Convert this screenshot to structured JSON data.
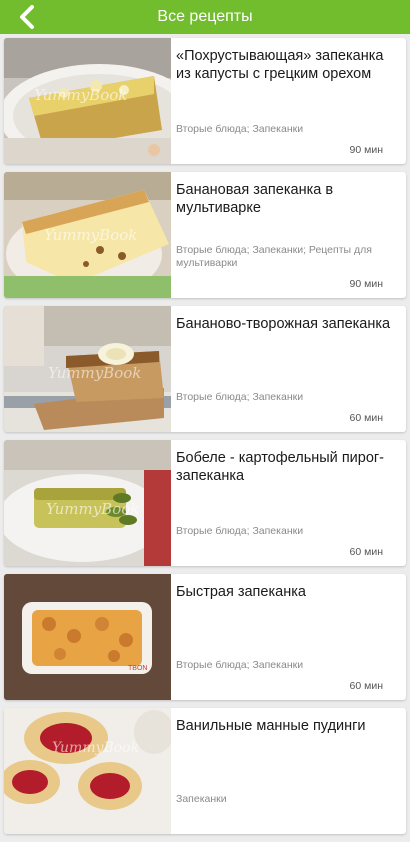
{
  "appbar": {
    "title": "Все рецепты",
    "back_icon": "chevron-left-icon",
    "background": "#72bd2d"
  },
  "recipes": [
    {
      "title": "«Похрустывающая» запеканка из капусты с грецким орехом",
      "category": "Вторые блюда; Запеканки",
      "time": "90 мин",
      "image": "cabbage-casserole-photo"
    },
    {
      "title": "Банановая запеканка в мультиварке",
      "category": "Вторые блюда; Запеканки; Рецепты для мультиварки",
      "time": "90 мин",
      "image": "banana-casserole-photo"
    },
    {
      "title": "Бананово-творожная запеканка",
      "category": "Вторые блюда; Запеканки",
      "time": "60 мин",
      "image": "banana-curd-casserole-photo"
    },
    {
      "title": "Бобеле - картофельный пирог- запеканка",
      "category": "Вторые блюда; Запеканки",
      "time": "60 мин",
      "image": "potato-pie-photo"
    },
    {
      "title": "Быстрая запеканка",
      "category": "Вторые блюда; Запеканки",
      "time": "60 мин",
      "image": "quick-casserole-photo"
    },
    {
      "title": "Ванильные манные пудинги",
      "category": "Запеканки",
      "time": "",
      "image": "semolina-pudding-photo"
    }
  ]
}
